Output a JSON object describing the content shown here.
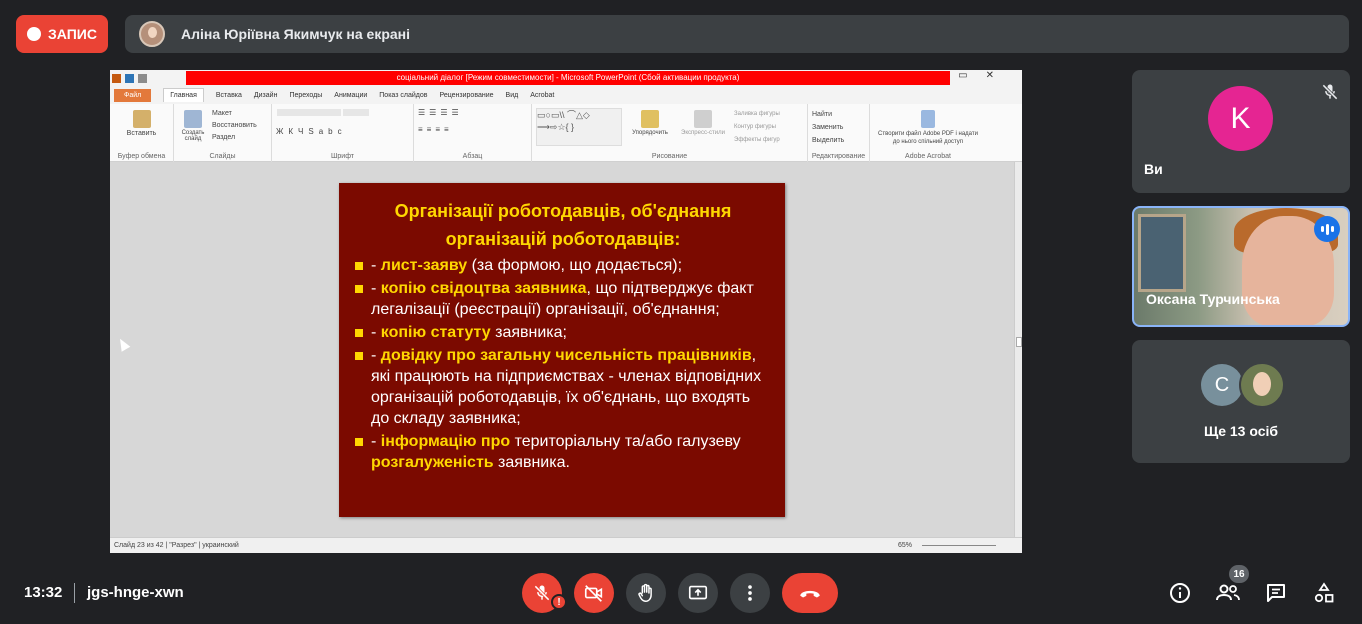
{
  "top_bar": {
    "record_label": "ЗАПИС",
    "presenting_text": "Аліна Юріївна Якимчук на екрані"
  },
  "ppt": {
    "window_title": "соціальний діалог [Режим совместимости] - Microsoft PowerPoint (Сбой активации продукта)",
    "tabs": [
      "Файл",
      "Главная",
      "Вставка",
      "Дизайн",
      "Переходы",
      "Анимации",
      "Показ слайдов",
      "Рецензирование",
      "Вид",
      "Acrobat"
    ],
    "groups": [
      "Буфер обмена",
      "Слайды",
      "Шрифт",
      "Абзац",
      "Рисование",
      "Редактирование",
      "Adobe Acrobat"
    ],
    "buttons": {
      "paste": "Вставить",
      "new_slide": "Создать слайд",
      "layout": "Макет",
      "reset": "Восстановить",
      "section": "Раздел",
      "arrange": "Упорядочить",
      "quick_styles": "Экспресс-стили",
      "shape_fill": "Заливка фигуры",
      "shape_outline": "Контур фигуры",
      "shape_effects": "Эффекты фигур",
      "find": "Найти",
      "replace": "Заменить",
      "select": "Выделить",
      "acrobat_create": "Створити файл Adobe PDF і надати до нього спільний доступ"
    },
    "status": {
      "slide": "Слайд 23 из 42",
      "theme": "\"Разрез\"",
      "lang": "украинский",
      "zoom": "65%"
    }
  },
  "slide": {
    "title": "Організації роботодавців, об'єднання організацій роботодавців:",
    "bullets": [
      {
        "pre": "- ",
        "bold": "лист-заяву",
        "rest": " (за формою, що додається);"
      },
      {
        "pre": "- ",
        "bold": "копію свідоцтва заявника",
        "rest": ", що підтверджує факт легалізації (реєстрації) організації, об'єднання;"
      },
      {
        "pre": "- ",
        "bold": "копію статуту",
        "rest": " заявника;"
      },
      {
        "pre": "- ",
        "bold": "довідку про загальну чисельність працівників",
        "rest": ", які працюють на підприємствах - членах відповідних організацій роботодавців, їх об'єднань, що входять до складу заявника;"
      },
      {
        "pre": "- ",
        "bold": "інформацію про",
        "rest": " територіальну та/або галузеву ",
        "bold2": "розгалуженість",
        "rest2": " заявника."
      }
    ]
  },
  "tiles": {
    "you": {
      "initial": "K",
      "name": "Ви"
    },
    "camera": {
      "name": "Оксана Турчинська"
    },
    "more": {
      "initial": "C",
      "label": "Ще 13 осіб"
    }
  },
  "bottom": {
    "time": "13:32",
    "meeting_code": "jgs-hnge-xwn",
    "participants_count": "16",
    "warning_mark": "!"
  },
  "colors": {
    "record": "#ea4335",
    "slide_bg": "#7b0a00",
    "slide_highlight": "#ffd700",
    "avatar_k": "#e52592",
    "speaking": "#1a73e8"
  }
}
